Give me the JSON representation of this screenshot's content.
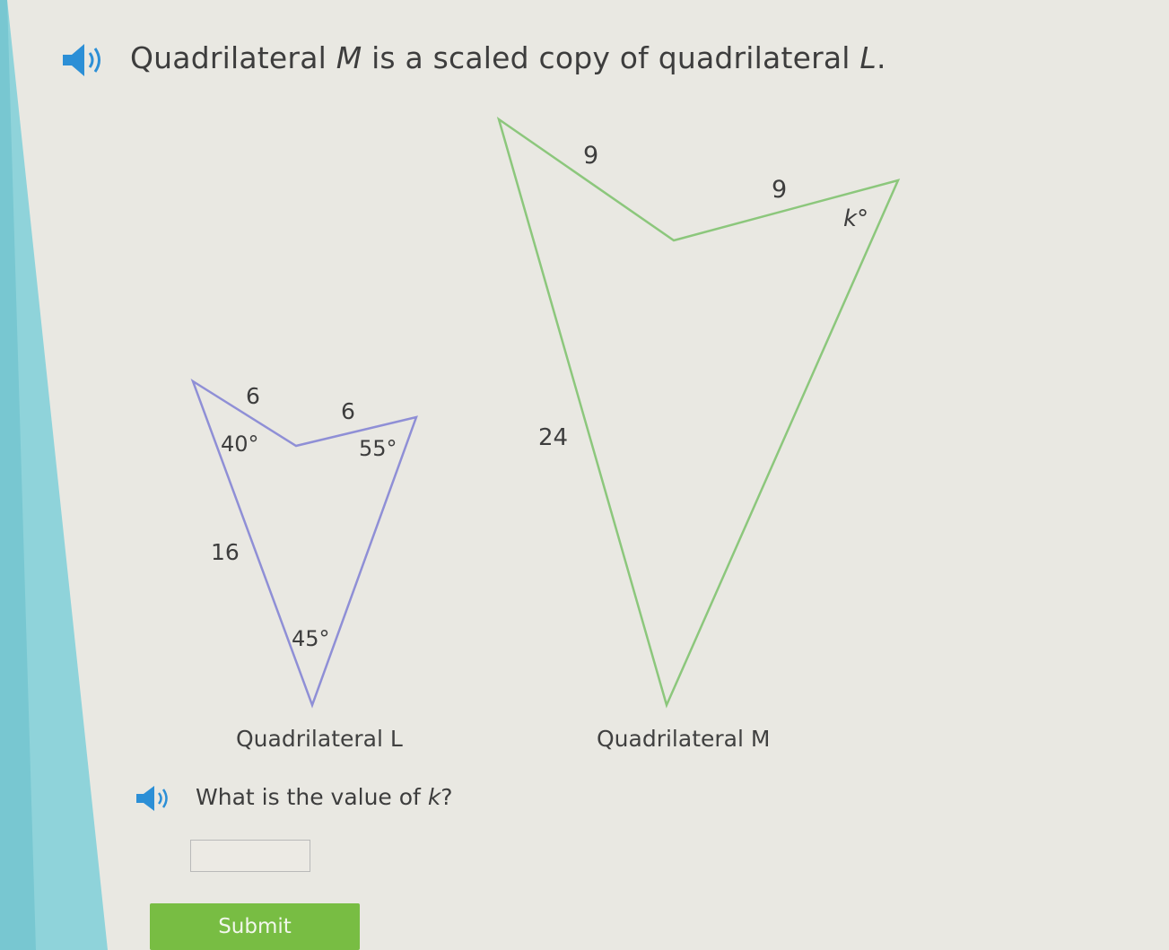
{
  "question": {
    "prefix": "Quadrilateral ",
    "var_m": "M",
    "middle": " is a scaled copy of quadrilateral ",
    "var_l": "L",
    "suffix": "."
  },
  "figure_l": {
    "caption": "Quadrilateral L",
    "side_top_left": "6",
    "side_top_right": "6",
    "side_left": "16",
    "angle_left": "40°",
    "angle_right": "55°",
    "angle_bottom": "45°"
  },
  "figure_m": {
    "caption": "Quadrilateral M",
    "side_top_left": "9",
    "side_top_right": "9",
    "side_left": "24",
    "angle_right_prefix": "k",
    "angle_right_suffix": "°"
  },
  "sub_question": {
    "prefix": "What is the value of ",
    "var_k": "k",
    "suffix": "?"
  },
  "answer": {
    "value": "",
    "placeholder": ""
  },
  "submit": {
    "label": "Submit"
  },
  "icons": {
    "speaker": "speaker-icon"
  },
  "colors": {
    "figure_l_stroke": "#8f8fd6",
    "figure_m_stroke": "#8cc77c",
    "submit_bg": "#78bd43",
    "left_strip": "#7ecfd8"
  }
}
